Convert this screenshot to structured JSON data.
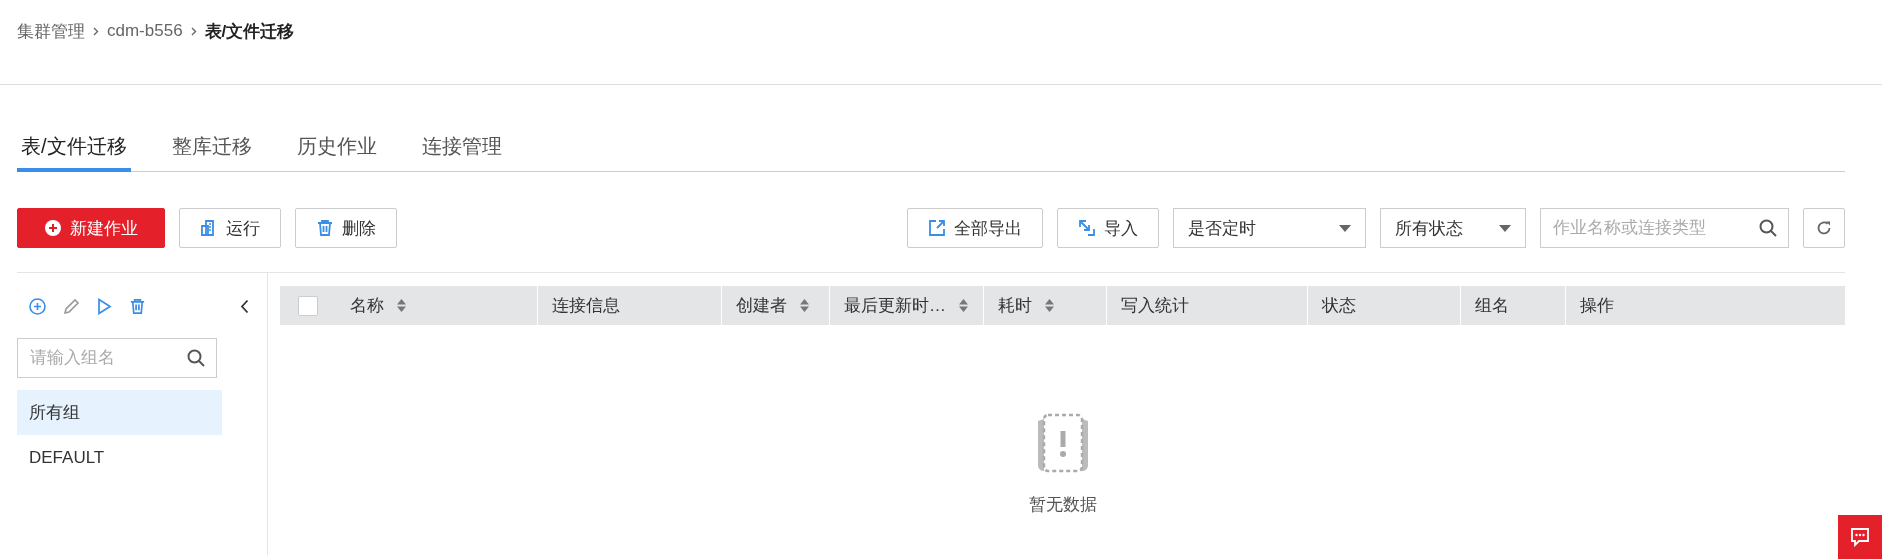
{
  "breadcrumb": [
    {
      "label": "集群管理",
      "current": false
    },
    {
      "label": "cdm-b556",
      "current": false
    },
    {
      "label": "表/文件迁移",
      "current": true
    }
  ],
  "tabs": [
    {
      "label": "表/文件迁移",
      "selected": true
    },
    {
      "label": "整库迁移",
      "selected": false
    },
    {
      "label": "历史作业",
      "selected": false
    },
    {
      "label": "连接管理",
      "selected": false
    }
  ],
  "actions": [
    {
      "label": "新建作业",
      "kind": "create"
    },
    {
      "label": "运行",
      "kind": "run"
    },
    {
      "label": "删除",
      "kind": "delete"
    }
  ],
  "tools": [
    {
      "label": "全部导出",
      "kind": "export"
    },
    {
      "label": "导入",
      "kind": "import"
    }
  ],
  "filters": [
    {
      "value": "是否定时"
    },
    {
      "value": "所有状态"
    }
  ],
  "search": {
    "placeholder": "作业名称或连接类型"
  },
  "groups": {
    "search_placeholder": "请输入组名",
    "items": [
      {
        "label": "所有组",
        "selected": true
      },
      {
        "label": "DEFAULT",
        "selected": false
      }
    ]
  },
  "table": {
    "select_all_checked": false,
    "columns": [
      {
        "label": "名称",
        "sortable": true
      },
      {
        "label": "连接信息",
        "sortable": false
      },
      {
        "label": "创建者",
        "sortable": true
      },
      {
        "label": "最后更新时…",
        "sortable": true
      },
      {
        "label": "耗时",
        "sortable": true
      },
      {
        "label": "写入统计",
        "sortable": false
      },
      {
        "label": "状态",
        "sortable": false
      },
      {
        "label": "组名",
        "sortable": false
      },
      {
        "label": "操作",
        "sortable": false
      }
    ],
    "empty_text": "暂无数据"
  }
}
